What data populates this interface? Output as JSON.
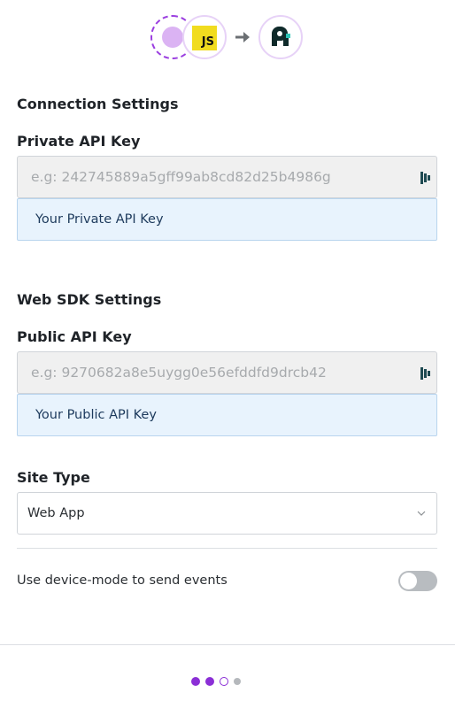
{
  "header": {
    "source_badge": "JS",
    "icons": [
      "source-placeholder-icon",
      "javascript-icon",
      "arrow-right-icon",
      "destination-logo-icon"
    ]
  },
  "connection": {
    "title": "Connection Settings",
    "private_key_label": "Private API Key",
    "private_key_placeholder": "e.g: 242745889a5gff99ab8cd82d25b4986g",
    "private_key_value": "",
    "private_key_hint": "Your Private API Key"
  },
  "web_sdk": {
    "title": "Web SDK Settings",
    "public_key_label": "Public API Key",
    "public_key_placeholder": "e.g: 9270682a8e5uygg0e56efddfd9drcb42",
    "public_key_value": "",
    "public_key_hint": "Your Public API Key",
    "site_type_label": "Site Type",
    "site_type_value": "Web App",
    "device_mode_label": "Use device-mode to send events",
    "device_mode_enabled": false
  },
  "stepper": {
    "steps": [
      "done",
      "done",
      "current",
      "todo"
    ]
  },
  "colors": {
    "accent": "#8b2fd6",
    "hint_bg": "#e8f3fd",
    "js_yellow": "#f1dc1f"
  }
}
